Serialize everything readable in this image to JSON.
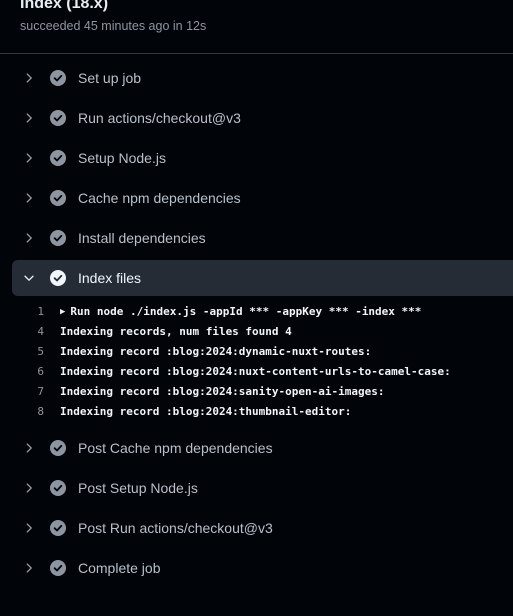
{
  "header": {
    "title": "Index (18.x)",
    "subtitle": "succeeded 45 minutes ago in 12s"
  },
  "steps_before": [
    {
      "label": "Set up job"
    },
    {
      "label": "Run actions/checkout@v3"
    },
    {
      "label": "Setup Node.js"
    },
    {
      "label": "Cache npm dependencies"
    },
    {
      "label": "Install dependencies"
    }
  ],
  "expanded_step": {
    "label": "Index files",
    "log": [
      {
        "num": "1",
        "text": "Run node ./index.js -appId *** -appKey *** -index ***",
        "collapsible": true
      },
      {
        "num": "4",
        "text": "Indexing records, num files found 4"
      },
      {
        "num": "5",
        "text": "Indexing record :blog:2024:dynamic-nuxt-routes:"
      },
      {
        "num": "6",
        "text": "Indexing record :blog:2024:nuxt-content-urls-to-camel-case:"
      },
      {
        "num": "7",
        "text": "Indexing record :blog:2024:sanity-open-ai-images:"
      },
      {
        "num": "8",
        "text": "Indexing record :blog:2024:thumbnail-editor:"
      }
    ]
  },
  "steps_after": [
    {
      "label": "Post Cache npm dependencies"
    },
    {
      "label": "Post Setup Node.js"
    },
    {
      "label": "Post Run actions/checkout@v3"
    },
    {
      "label": "Complete job"
    }
  ],
  "colors": {
    "check_fill": "#8d96a0",
    "expanded_bg": "#262c36",
    "background": "#010409"
  }
}
